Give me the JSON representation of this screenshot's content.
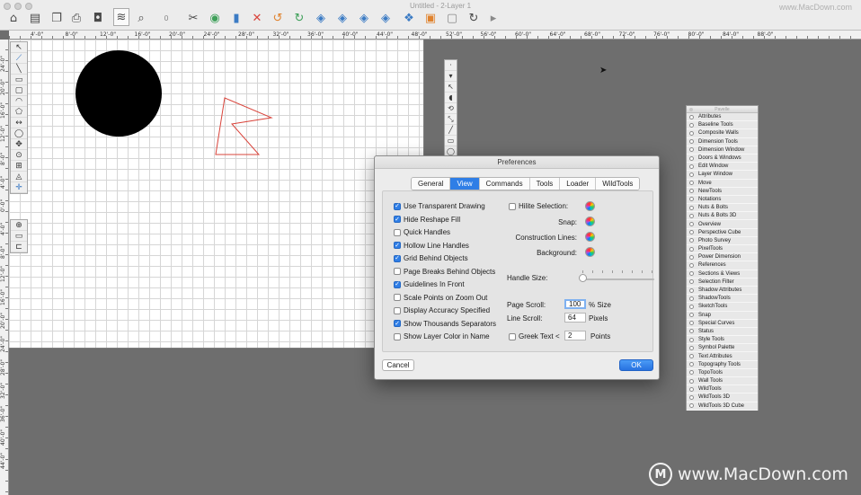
{
  "window": {
    "title": "Untitled - 2-Layer 1",
    "watermark_top": "www.MacDown.com"
  },
  "toolbar": {
    "zoom_value": "0"
  },
  "ruler": {
    "h_labels": [
      "4'-0\"",
      "8'-0\"",
      "12'-0\"",
      "16'-0\"",
      "20'-0\"",
      "24'-0\"",
      "28'-0\"",
      "32'-0\"",
      "36'-0\"",
      "40'-0\"",
      "44'-0\"",
      "48'-0\"",
      "52'-0\"",
      "56'-0\"",
      "60'-0\"",
      "64'-0\"",
      "68'-0\"",
      "72'-0\"",
      "76'-0\"",
      "80'-0\"",
      "84'-0\"",
      "88'-0\""
    ],
    "v_labels": [
      "24'-0\"",
      "20'-0\"",
      "16'-0\"",
      "12'-0\"",
      "8'-0\"",
      "4'-0\"",
      "0'-0\"",
      "4'-0\"",
      "8'-0\"",
      "12'-0\"",
      "16'-0\"",
      "20'-0\"",
      "24'-0\"",
      "28'-0\"",
      "32'-0\"",
      "36'-0\"",
      "40'-0\"",
      "44'-0\""
    ]
  },
  "dialog": {
    "title": "Preferences",
    "tabs": [
      "General",
      "View",
      "Commands",
      "Tools",
      "Loader",
      "WildTools"
    ],
    "active_tab": "View",
    "checkboxes": [
      {
        "label": "Use Transparent Drawing",
        "checked": true
      },
      {
        "label": "Hide Reshape Fill",
        "checked": true
      },
      {
        "label": "Quick Handles",
        "checked": false
      },
      {
        "label": "Hollow Line Handles",
        "checked": true
      },
      {
        "label": "Grid Behind Objects",
        "checked": true
      },
      {
        "label": "Page Breaks Behind Objects",
        "checked": false
      },
      {
        "label": "Guidelines In Front",
        "checked": true
      },
      {
        "label": "Scale Points on Zoom Out",
        "checked": false
      },
      {
        "label": "Display Accuracy Specified",
        "checked": false
      },
      {
        "label": "Show Thousands Separators",
        "checked": true
      },
      {
        "label": "Show Layer Color in Name",
        "checked": false
      }
    ],
    "hilite_selection": {
      "label": "Hilite Selection:",
      "checked": false
    },
    "snap_label": "Snap:",
    "construction_lines_label": "Construction Lines:",
    "background_label": "Background:",
    "handle_size_label": "Handle Size:",
    "page_scroll": {
      "label": "Page Scroll:",
      "value": "100",
      "unit": "% Size"
    },
    "line_scroll": {
      "label": "Line Scroll:",
      "value": "64",
      "unit": "Pixels"
    },
    "greek_text": {
      "label": "Greek Text",
      "operator": "<",
      "value": "2",
      "unit": "Points",
      "checked": false
    },
    "cancel_label": "Cancel",
    "ok_label": "OK"
  },
  "palette_window": {
    "title": "Pavelle",
    "items": [
      "Attributes",
      "Baseline Tools",
      "Composite Walls",
      "Dimension Tools",
      "Dimension Window",
      "Doors & Windows",
      "Edit Window",
      "Layer Window",
      "Move",
      "NewTools",
      "Notations",
      "Nuts & Bolts",
      "Nuts & Bolts 3D",
      "Overview",
      "Perspective Cube",
      "Photo Survey",
      "PixelTools",
      "Power Dimension",
      "References",
      "Sections & Views",
      "Selection Filter",
      "Shadow Attributes",
      "ShadowTools",
      "SketchTools",
      "Snap",
      "Special Curves",
      "Status",
      "Style Tools",
      "Symbol Palette",
      "Text Attributes",
      "Topography Tools",
      "TopoTools",
      "Wall Tools",
      "WildTools",
      "WildTools 3D",
      "WildTools 3D Cube"
    ]
  },
  "watermark": {
    "text": "www.MacDown.com",
    "logo_glyph": "M"
  },
  "colors": {
    "accent": "#2f7ee6",
    "shape_fill": "#000000",
    "polygon_stroke": "#d9443b"
  }
}
